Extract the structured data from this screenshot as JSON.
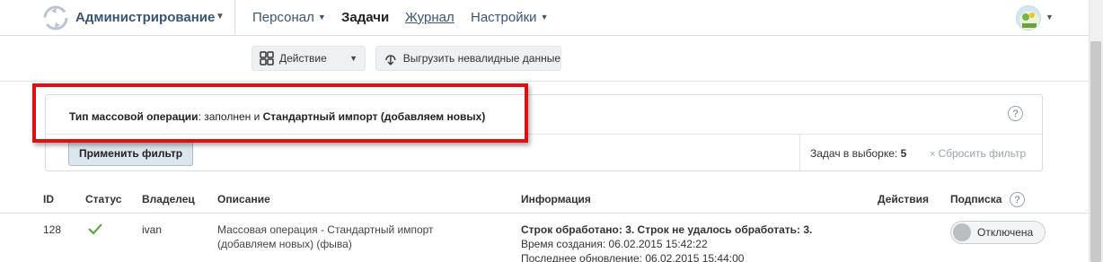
{
  "header": {
    "app_title": "Администрирование",
    "nav": [
      {
        "label": "Персонал",
        "has_dropdown": true
      },
      {
        "label": "Задачи",
        "active": true
      },
      {
        "label": "Журнал",
        "link": true
      },
      {
        "label": "Настройки",
        "has_dropdown": true
      }
    ]
  },
  "toolbar": {
    "action_label": "Действие",
    "export_label": "Выгрузить невалидные данные"
  },
  "filter": {
    "field_label": "Тип массовой операции",
    "operator_text": ": заполнен и ",
    "value_label": "Стандартный импорт (добавляем новых)",
    "help": "?",
    "apply_label": "Применить фильтр",
    "count_label": "Задач в выборке: ",
    "count_value": "5",
    "reset_icon": "×",
    "reset_label": "Сбросить фильтр"
  },
  "table": {
    "headers": {
      "id": "ID",
      "status": "Статус",
      "owner": "Владелец",
      "description": "Описание",
      "info": "Информация",
      "actions": "Действия",
      "subscription": "Подписка"
    },
    "rows": [
      {
        "id": "128",
        "status": "check-icon",
        "owner": "ivan",
        "description": "Массовая операция - Стандартный импорт (добавляем новых) (фыва)",
        "info_summary": "Строк обработано: 3. Строк не удалось обработать: 3.",
        "info_created": "Время создания: 06.02.2015 15:42:22",
        "info_updated": "Последнее обновление: 06.02.2015 15:44:00",
        "subscription": "Отключена"
      }
    ]
  },
  "colors": {
    "highlight": "#e01010",
    "nav_text": "#3a5572",
    "check": "#5a9e3a"
  }
}
